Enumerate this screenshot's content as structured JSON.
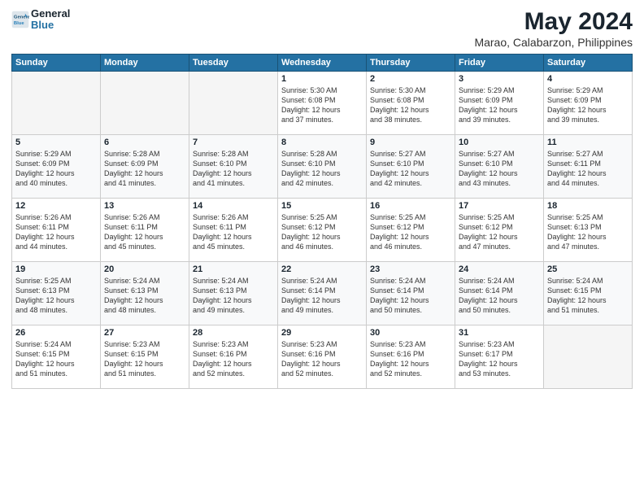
{
  "header": {
    "logo_line1": "General",
    "logo_line2": "Blue",
    "month": "May 2024",
    "location": "Marao, Calabarzon, Philippines"
  },
  "weekdays": [
    "Sunday",
    "Monday",
    "Tuesday",
    "Wednesday",
    "Thursday",
    "Friday",
    "Saturday"
  ],
  "weeks": [
    [
      {
        "day": "",
        "text": ""
      },
      {
        "day": "",
        "text": ""
      },
      {
        "day": "",
        "text": ""
      },
      {
        "day": "1",
        "text": "Sunrise: 5:30 AM\nSunset: 6:08 PM\nDaylight: 12 hours\nand 37 minutes."
      },
      {
        "day": "2",
        "text": "Sunrise: 5:30 AM\nSunset: 6:08 PM\nDaylight: 12 hours\nand 38 minutes."
      },
      {
        "day": "3",
        "text": "Sunrise: 5:29 AM\nSunset: 6:09 PM\nDaylight: 12 hours\nand 39 minutes."
      },
      {
        "day": "4",
        "text": "Sunrise: 5:29 AM\nSunset: 6:09 PM\nDaylight: 12 hours\nand 39 minutes."
      }
    ],
    [
      {
        "day": "5",
        "text": "Sunrise: 5:29 AM\nSunset: 6:09 PM\nDaylight: 12 hours\nand 40 minutes."
      },
      {
        "day": "6",
        "text": "Sunrise: 5:28 AM\nSunset: 6:09 PM\nDaylight: 12 hours\nand 41 minutes."
      },
      {
        "day": "7",
        "text": "Sunrise: 5:28 AM\nSunset: 6:10 PM\nDaylight: 12 hours\nand 41 minutes."
      },
      {
        "day": "8",
        "text": "Sunrise: 5:28 AM\nSunset: 6:10 PM\nDaylight: 12 hours\nand 42 minutes."
      },
      {
        "day": "9",
        "text": "Sunrise: 5:27 AM\nSunset: 6:10 PM\nDaylight: 12 hours\nand 42 minutes."
      },
      {
        "day": "10",
        "text": "Sunrise: 5:27 AM\nSunset: 6:10 PM\nDaylight: 12 hours\nand 43 minutes."
      },
      {
        "day": "11",
        "text": "Sunrise: 5:27 AM\nSunset: 6:11 PM\nDaylight: 12 hours\nand 44 minutes."
      }
    ],
    [
      {
        "day": "12",
        "text": "Sunrise: 5:26 AM\nSunset: 6:11 PM\nDaylight: 12 hours\nand 44 minutes."
      },
      {
        "day": "13",
        "text": "Sunrise: 5:26 AM\nSunset: 6:11 PM\nDaylight: 12 hours\nand 45 minutes."
      },
      {
        "day": "14",
        "text": "Sunrise: 5:26 AM\nSunset: 6:11 PM\nDaylight: 12 hours\nand 45 minutes."
      },
      {
        "day": "15",
        "text": "Sunrise: 5:25 AM\nSunset: 6:12 PM\nDaylight: 12 hours\nand 46 minutes."
      },
      {
        "day": "16",
        "text": "Sunrise: 5:25 AM\nSunset: 6:12 PM\nDaylight: 12 hours\nand 46 minutes."
      },
      {
        "day": "17",
        "text": "Sunrise: 5:25 AM\nSunset: 6:12 PM\nDaylight: 12 hours\nand 47 minutes."
      },
      {
        "day": "18",
        "text": "Sunrise: 5:25 AM\nSunset: 6:13 PM\nDaylight: 12 hours\nand 47 minutes."
      }
    ],
    [
      {
        "day": "19",
        "text": "Sunrise: 5:25 AM\nSunset: 6:13 PM\nDaylight: 12 hours\nand 48 minutes."
      },
      {
        "day": "20",
        "text": "Sunrise: 5:24 AM\nSunset: 6:13 PM\nDaylight: 12 hours\nand 48 minutes."
      },
      {
        "day": "21",
        "text": "Sunrise: 5:24 AM\nSunset: 6:13 PM\nDaylight: 12 hours\nand 49 minutes."
      },
      {
        "day": "22",
        "text": "Sunrise: 5:24 AM\nSunset: 6:14 PM\nDaylight: 12 hours\nand 49 minutes."
      },
      {
        "day": "23",
        "text": "Sunrise: 5:24 AM\nSunset: 6:14 PM\nDaylight: 12 hours\nand 50 minutes."
      },
      {
        "day": "24",
        "text": "Sunrise: 5:24 AM\nSunset: 6:14 PM\nDaylight: 12 hours\nand 50 minutes."
      },
      {
        "day": "25",
        "text": "Sunrise: 5:24 AM\nSunset: 6:15 PM\nDaylight: 12 hours\nand 51 minutes."
      }
    ],
    [
      {
        "day": "26",
        "text": "Sunrise: 5:24 AM\nSunset: 6:15 PM\nDaylight: 12 hours\nand 51 minutes."
      },
      {
        "day": "27",
        "text": "Sunrise: 5:23 AM\nSunset: 6:15 PM\nDaylight: 12 hours\nand 51 minutes."
      },
      {
        "day": "28",
        "text": "Sunrise: 5:23 AM\nSunset: 6:16 PM\nDaylight: 12 hours\nand 52 minutes."
      },
      {
        "day": "29",
        "text": "Sunrise: 5:23 AM\nSunset: 6:16 PM\nDaylight: 12 hours\nand 52 minutes."
      },
      {
        "day": "30",
        "text": "Sunrise: 5:23 AM\nSunset: 6:16 PM\nDaylight: 12 hours\nand 52 minutes."
      },
      {
        "day": "31",
        "text": "Sunrise: 5:23 AM\nSunset: 6:17 PM\nDaylight: 12 hours\nand 53 minutes."
      },
      {
        "day": "",
        "text": ""
      }
    ]
  ]
}
